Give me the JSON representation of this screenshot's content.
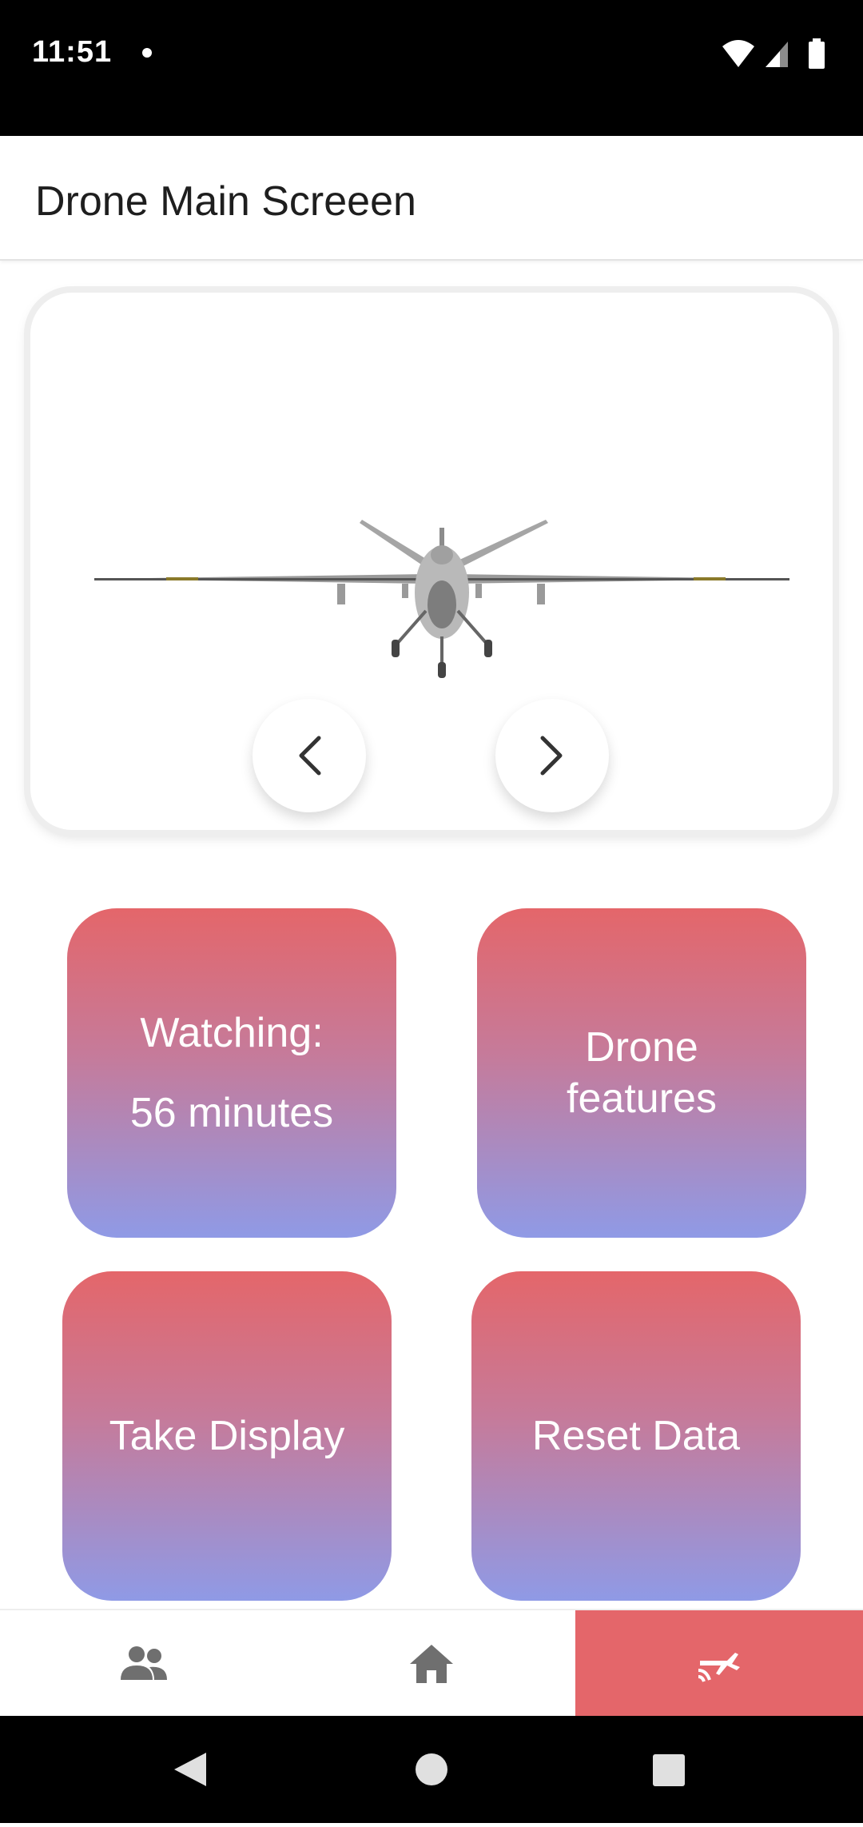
{
  "status_bar": {
    "time": "11:51"
  },
  "app_bar": {
    "title": "Drone Main Screeen"
  },
  "viewer": {
    "image": "drone-3d-model",
    "prev_icon": "chevron-left-icon",
    "next_icon": "chevron-right-icon"
  },
  "tiles": {
    "watching": {
      "line1": "Watching:",
      "line2": "56 minutes"
    },
    "features": {
      "line1": "Drone",
      "line2": "features"
    },
    "take_display": {
      "label": "Take Display"
    },
    "reset_data": {
      "label": "Reset Data"
    },
    "gradient": [
      "#e4666a",
      "#8f9ae6"
    ]
  },
  "bottom_nav": {
    "items": [
      {
        "icon": "people-icon",
        "active": false
      },
      {
        "icon": "home-icon",
        "active": false
      },
      {
        "icon": "drone-signal-icon",
        "active": true
      }
    ],
    "active_color": "#e4666a"
  }
}
